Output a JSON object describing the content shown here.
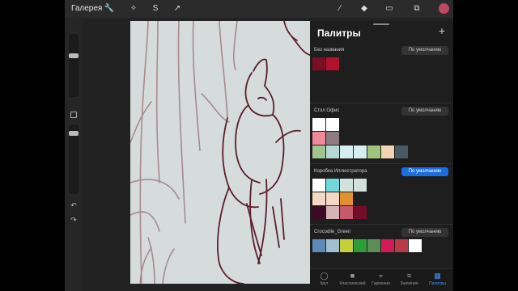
{
  "topbar": {
    "gallery_label": "Галерея",
    "tools": [
      "wrench-icon",
      "magic-wand-icon",
      "selection-icon",
      "transform-arrow-icon",
      "brush-icon",
      "smudge-icon",
      "eraser-icon",
      "layers-icon"
    ],
    "active_color": "#c0485e"
  },
  "palettes_panel": {
    "title": "Палитры",
    "add_symbol": "+",
    "palettes": [
      {
        "name": "Без названия",
        "button": "По умолчанию",
        "default": false,
        "rows": [
          [
            "#7a0e22",
            "#b3122e"
          ]
        ]
      },
      {
        "name": "Стол Офис",
        "button": "По умолчанию",
        "default": false,
        "rows": [
          [
            "#ffffff",
            "#ffffff"
          ],
          [
            "#f08a9a",
            "#8e7a80"
          ],
          [
            "#9ec491",
            "#b7d7d5",
            "#d6eef1",
            "#d6eef1",
            "#9ec67c",
            "#f2d3b2",
            "#4a5a62"
          ]
        ]
      },
      {
        "name": "Коробка Иллюстратора",
        "button": "По умолчанию",
        "default": true,
        "rows": [
          [
            "#ffffff",
            "#6fd9d9",
            "#cfe2dc",
            "#cfe2dc"
          ],
          [
            "#f3d8c3",
            "#f3d8c3",
            "#e19031"
          ],
          [
            "#3d0a24",
            "#d7b4b7",
            "#c45a6a",
            "#740c2a"
          ]
        ]
      },
      {
        "name": "Crocodile_Green",
        "button": "По умолчанию",
        "default": false,
        "rows": [
          [
            "#5e8ab8",
            "#9fbfd3",
            "#c5cf3a",
            "#2e9e3a",
            "#5d8d56",
            "#d41b56",
            "#b93a48",
            "#ffffff"
          ]
        ]
      }
    ],
    "tabs": [
      {
        "label": "Круг",
        "icon": "circle-icon"
      },
      {
        "label": "Классический",
        "icon": "square-icon"
      },
      {
        "label": "Гармония",
        "icon": "harmony-icon"
      },
      {
        "label": "Значения",
        "icon": "sliders-icon"
      },
      {
        "label": "Палитры",
        "icon": "grid-icon",
        "active": true
      }
    ]
  }
}
